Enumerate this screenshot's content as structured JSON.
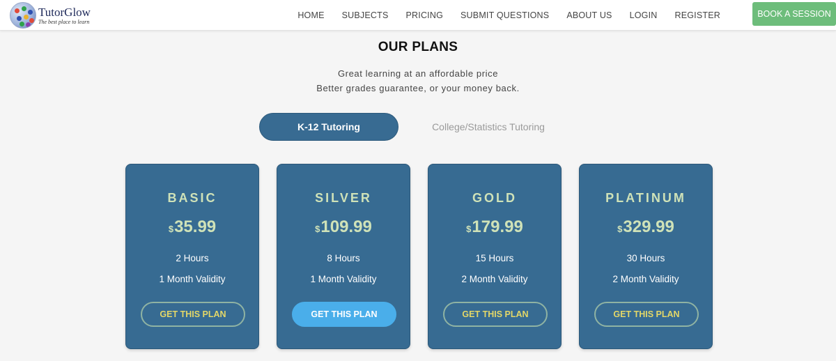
{
  "header": {
    "logo_name": "TutorGlow",
    "logo_tagline": "The best place to learn",
    "nav": [
      "HOME",
      "SUBJECTS",
      "PRICING",
      "SUBMIT QUESTIONS",
      "ABOUT US",
      "LOGIN",
      "REGISTER"
    ],
    "book_button": "BOOK A SESSION"
  },
  "section": {
    "title": "OUR PLANS",
    "subtitle_line1": "Great learning at an affordable price",
    "subtitle_line2": "Better grades guarantee, or your money back."
  },
  "tabs": {
    "active": "K-12 Tutoring",
    "inactive": "College/Statistics Tutoring"
  },
  "plans": [
    {
      "name": "BASIC",
      "currency": "$",
      "price": "35.99",
      "hours": "2 Hours",
      "validity": "1 Month Validity",
      "button": "GET THIS PLAN"
    },
    {
      "name": "SILVER",
      "currency": "$",
      "price": "109.99",
      "hours": "8 Hours",
      "validity": "1 Month Validity",
      "button": "GET THIS PLAN"
    },
    {
      "name": "GOLD",
      "currency": "$",
      "price": "179.99",
      "hours": "15 Hours",
      "validity": "2 Month Validity",
      "button": "GET THIS PLAN"
    },
    {
      "name": "PLATINUM",
      "currency": "$",
      "price": "329.99",
      "hours": "30 Hours",
      "validity": "2 Month Validity",
      "button": "GET THIS PLAN"
    }
  ],
  "colors": {
    "card_background": "#376b92",
    "book_button": "#6dbd7b",
    "highlight_button": "#4aaeea",
    "plan_title": "#cfe2b8",
    "plan_button_text": "#e3d768"
  }
}
